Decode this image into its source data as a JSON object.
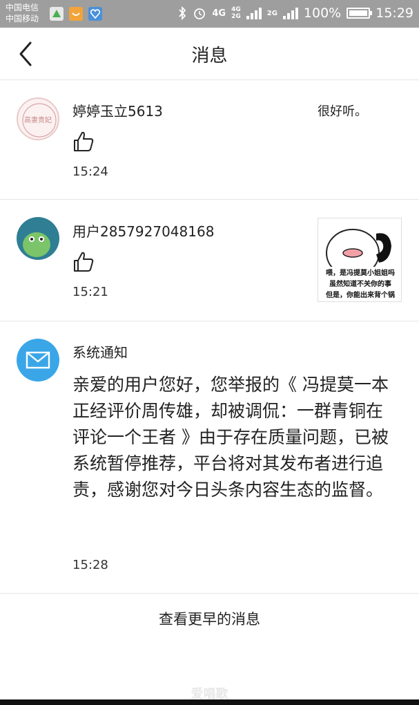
{
  "status_bar": {
    "carrier_1": "中国电信",
    "carrier_2": "中国移动",
    "network_1": "4G",
    "network_2_top": "4G",
    "network_2_bottom": "2G",
    "network_3": "2G",
    "battery": "100%",
    "time": "15:29",
    "icons": [
      "app-icon-green",
      "app-icon-orange",
      "app-icon-blue",
      "bluetooth-icon",
      "alarm-icon",
      "signal-icon",
      "battery-charging-icon"
    ]
  },
  "header": {
    "title": "消息",
    "back_icon": "back-arrow-icon"
  },
  "messages": [
    {
      "username": "婷婷玉立5613",
      "reply_text": "很好听。",
      "time": "15:24",
      "avatar_text": "高妻贵妃"
    },
    {
      "username": "用户2857927048168",
      "time": "15:21",
      "thumb_line_1": "喂，是冯提莫小姐姐吗",
      "thumb_line_2": "虽然知道不关你的事",
      "thumb_line_3": "但是，你能出来背个锅吗？"
    },
    {
      "username": "系统通知",
      "body": "亲爱的用户您好，您举报的《 冯提莫一本正经评价周传雄，却被调侃：一群青铜在评论一个王者 》由于存在质量问题，已被系统暂停推荐，平台将对其发布者进行追责，感谢您对今日头条内容生态的监督。",
      "time": "15:28"
    }
  ],
  "footer": {
    "more_label": "查看更早的消息",
    "watermark": "爱唱歌"
  },
  "colors": {
    "status_bar": "#9e9e9e",
    "system_avatar": "#3aa6e8",
    "divider": "#e6e6e6"
  }
}
